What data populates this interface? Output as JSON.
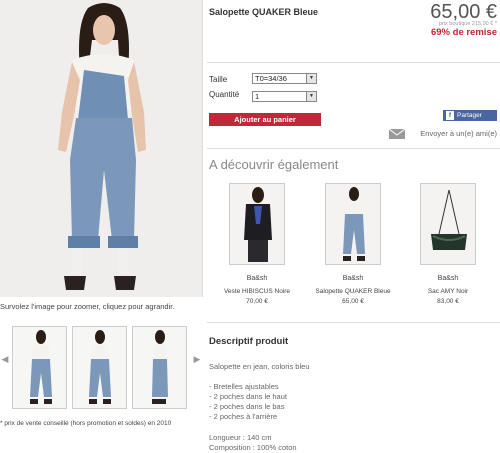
{
  "product": {
    "title": "Salopette QUAKER Bleue",
    "price": "65,00 €",
    "original_price": "prix boutique 215,00 € *",
    "discount": "69% de remise"
  },
  "options": {
    "size_label": "Taille",
    "size_value": "T0=34/36",
    "qty_label": "Quantité",
    "qty_value": "1"
  },
  "actions": {
    "add_to_cart": "Ajouter au panier",
    "share": "Partager",
    "send_friend": "Envoyer à un(e) ami(e)"
  },
  "gallery": {
    "zoom_hint": "Survolez l'image pour zoomer, cliquez pour agrandir.",
    "price_note": "* prix de vente conseillé (hors promotion et soldes) en 2010"
  },
  "discover": {
    "title": "A découvrir également",
    "products": [
      {
        "brand": "Ba&sh",
        "name": "Veste HIBISCUS Noire",
        "price": "70,00 €"
      },
      {
        "brand": "Ba&sh",
        "name": "Salopette QUAKER Bleue",
        "price": "65,00 €"
      },
      {
        "brand": "Ba&sh",
        "name": "Sac AMY Noir",
        "price": "83,00 €"
      }
    ]
  },
  "description": {
    "title": "Descriptif produit",
    "intro": "Salopette en jean, coloris bleu",
    "features": [
      "- Bretelles ajustables",
      "- 2 poches dans le haut",
      "- 2 poches dans le bas",
      "- 2 poches à l'arrière"
    ],
    "length": "Longueur : 140 cm",
    "composition": "Composition : 100% coton"
  },
  "colors": {
    "accent": "#c0283a",
    "facebook": "#4a66a0",
    "denim": "#6f8fb4"
  },
  "icons": [
    "prev-arrow-icon",
    "next-arrow-icon",
    "facebook-icon",
    "mail-icon",
    "dropdown-arrow-icon"
  ]
}
